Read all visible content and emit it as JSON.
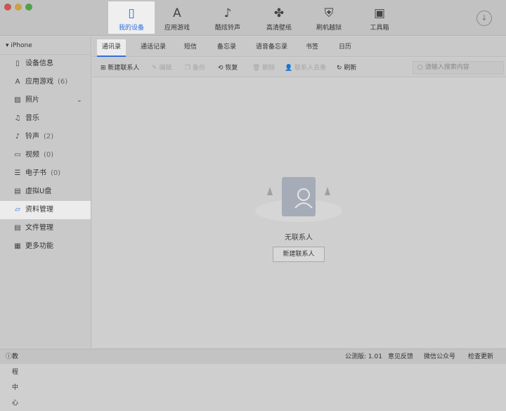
{
  "nav": [
    {
      "label": "我的设备",
      "icon": "phone-icon",
      "glyph": "▯"
    },
    {
      "label": "应用游戏",
      "icon": "app-store-icon",
      "glyph": "A"
    },
    {
      "label": "酷炫铃声",
      "icon": "music-note-icon",
      "glyph": "♪"
    },
    {
      "label": "高清壁纸",
      "icon": "clover-icon",
      "glyph": "✤"
    },
    {
      "label": "刷机越狱",
      "icon": "shield-key-icon",
      "glyph": "⛨"
    },
    {
      "label": "工具箱",
      "icon": "toolbox-icon",
      "glyph": "▣"
    }
  ],
  "download_glyph": "↓",
  "device": "iPhone",
  "sidebar": [
    {
      "label": "设备信息",
      "glyph": "▯"
    },
    {
      "label": "应用游戏",
      "count": "(6)",
      "glyph": "A"
    },
    {
      "label": "照片",
      "glyph": "▨"
    },
    {
      "label": "音乐",
      "glyph": "♫"
    },
    {
      "label": "铃声",
      "count": "(2)",
      "glyph": "♪"
    },
    {
      "label": "视频",
      "count": "(0)",
      "glyph": "▭"
    },
    {
      "label": "电子书",
      "count": "(0)",
      "glyph": "☰"
    },
    {
      "label": "虚拟U盘",
      "glyph": "▤"
    },
    {
      "label": "资料管理",
      "glyph": "▱"
    },
    {
      "label": "文件管理",
      "glyph": "▤"
    },
    {
      "label": "更多功能",
      "glyph": "▦"
    }
  ],
  "tabs": [
    "通讯录",
    "通话记录",
    "短信",
    "备忘录",
    "语音备忘录",
    "书签",
    "日历"
  ],
  "toolbar": {
    "new": "新建联系人",
    "edit": "编辑",
    "backup": "备份",
    "restore": "恢复",
    "delete": "删除",
    "dedupe": "联系人去重",
    "refresh": "刷新",
    "search_placeholder": "请输入搜索内容"
  },
  "empty": {
    "text": "无联系人",
    "button": "新建联系人"
  },
  "footer": {
    "help": "教程中心",
    "version": "公测版: 1.01",
    "feedback": "意见反馈",
    "wechat": "微信公众号",
    "update": "检查更新"
  }
}
